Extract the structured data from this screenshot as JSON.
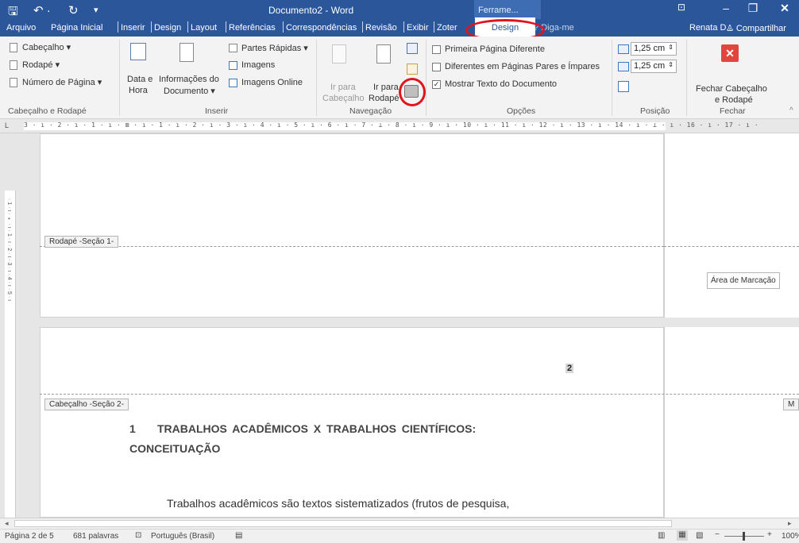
{
  "title_bar": {
    "doc_title": "Documento2 - Word",
    "context_group": "Ferrame...",
    "save_glyph": "🖫",
    "undo_glyph": "↶ ·",
    "redo_glyph": "↻",
    "qat_glyph": "▾"
  },
  "tabs": [
    {
      "label": "Arquivo"
    },
    {
      "label": "Página Inicial"
    },
    {
      "label": "Inserir"
    },
    {
      "label": "Design"
    },
    {
      "label": "Layout"
    },
    {
      "label": "Referências"
    },
    {
      "label": "Correspondências"
    },
    {
      "label": "Revisão"
    },
    {
      "label": "Exibir"
    },
    {
      "label": "Zoter"
    }
  ],
  "active_tab": "Design",
  "tell_me": "Diga-me",
  "user": "Renata D...",
  "share": "Compartilhar",
  "ribbon": {
    "header_footer": {
      "cabecalho": "Cabeçalho ▾",
      "rodape": "Rodapé ▾",
      "numero_pagina": "Número de Página ▾",
      "label": "Cabeçalho e Rodapé"
    },
    "inserir": {
      "data_hora_1": "Data e",
      "data_hora_2": "Hora",
      "info_doc_1": "Informações do",
      "info_doc_2": "Documento ▾",
      "partes_rapidas": "Partes Rápidas ▾",
      "imagens": "Imagens",
      "imagens_online": "Imagens Online",
      "label": "Inserir"
    },
    "navegacao": {
      "ir_cab_1": "Ir para",
      "ir_cab_2": "Cabeçalho",
      "ir_rod_1": "Ir para",
      "ir_rod_2": "Rodapé",
      "label": "Navegação"
    },
    "opcoes": {
      "primeira": "Primeira Página Diferente",
      "pares": "Diferentes em Páginas Pares e Ímpares",
      "mostrar": "Mostrar Texto do Documento",
      "label": "Opções"
    },
    "posicao": {
      "top_value": "1,25 cm",
      "bottom_value": "1,25 cm",
      "label": "Posição"
    },
    "fechar": {
      "btn_1": "Fechar Cabeçalho",
      "btn_2": "e Rodapé",
      "label": "Fechar"
    }
  },
  "ruler_text": "3 · ı · 2 · ı · 1 · ı · ⊠ · ı · 1 · ı · 2 · ı · 3 · ı · 4 · ı · 5 · ı · 6 · ı · 7 · ⊥ · 8 · ı · 9 · ı · 10 · ı · 11 · ı · 12 · ı · 13 · ı · 14 · ı · ⊥ · ı · 16 · ı · 17 · ı ·",
  "document": {
    "footer_tag": "Rodapé -Seção 1-",
    "markup_area": "Área de Marcação",
    "page_number": "2",
    "header_tag": "Cabeçalho -Seção 2-",
    "margin_tag": "M",
    "heading_num": "1",
    "heading_line1": "TRABALHOS    ACADÊMICOS    X    TRABALHOS    CIENTÍFICOS:",
    "heading_line2": "CONCEITUAÇÃO",
    "body_line": "Trabalhos  acadêmicos  são  textos  sistematizados  (frutos  de  pesquisa,"
  },
  "status": {
    "page": "Página 2 de 5",
    "words": "681 palavras",
    "language": "Português (Brasil)",
    "zoom": "100%"
  },
  "colors": {
    "title_bar": "#2b579a",
    "highlight_ring": "#e0141e",
    "close_button": "#e0463c"
  }
}
